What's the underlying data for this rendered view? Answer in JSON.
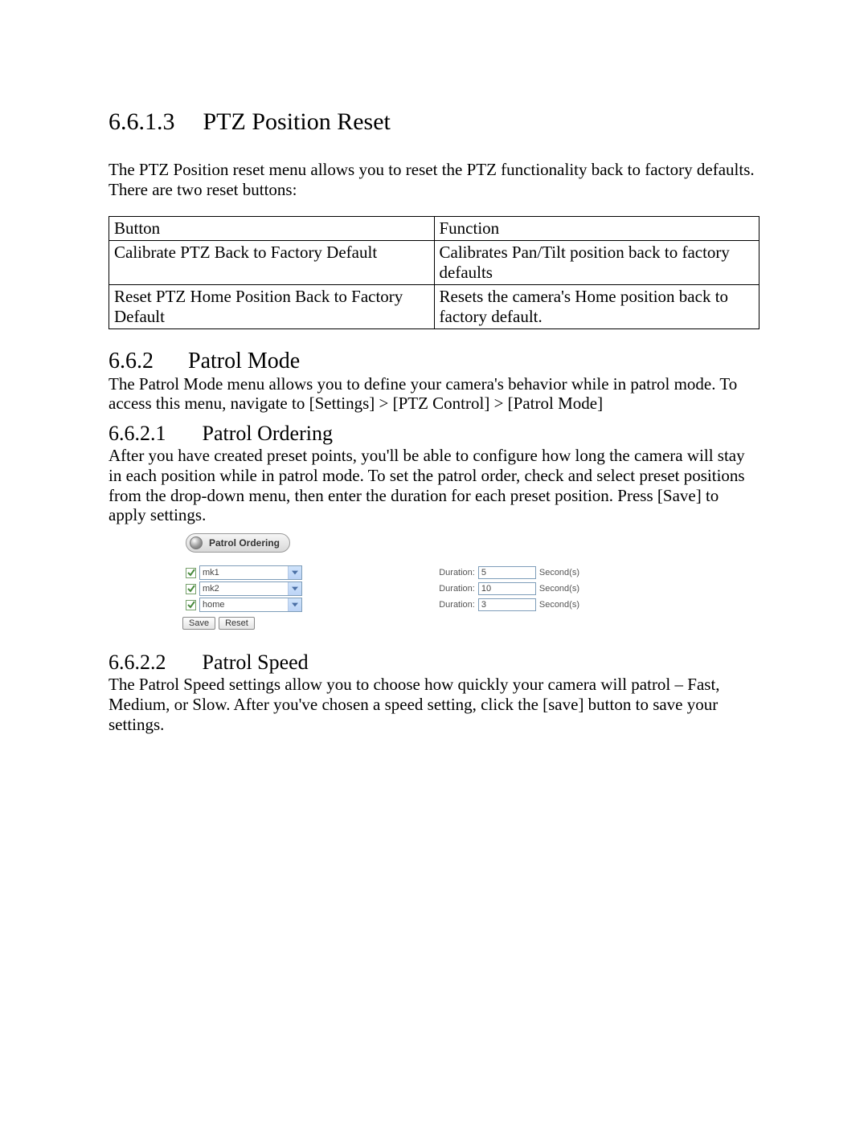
{
  "sec6613": {
    "num": "6.6.1.3",
    "title": "PTZ Position Reset",
    "para": "The PTZ Position reset menu allows you to reset the PTZ functionality back to factory defaults. There are two reset buttons:",
    "table": {
      "h1": "Button",
      "h2": "Function",
      "r1c1": "Calibrate PTZ Back to Factory Default",
      "r1c2": "Calibrates Pan/Tilt position back to factory defaults",
      "r2c1": "Reset PTZ Home Position Back to Factory Default",
      "r2c2": "Resets the camera's Home position back to factory default."
    }
  },
  "sec662": {
    "num": "6.6.2",
    "title": "Patrol Mode",
    "para": "The Patrol Mode menu allows you to define your camera's behavior while in patrol mode. To access this menu, navigate to [Settings] > [PTZ Control] > [Patrol Mode]"
  },
  "sec6621": {
    "num": "6.6.2.1",
    "title": "Patrol Ordering",
    "para": "After you have created preset points, you'll be able to configure how long the camera will stay in each position while in patrol mode. To set the patrol order, check and select preset positions from the drop-down menu, then enter the duration for each preset position. Press [Save] to apply settings."
  },
  "patrol_ui": {
    "panel_title": "Patrol Ordering",
    "duration_label": "Duration:",
    "seconds_label": "Second(s)",
    "save": "Save",
    "reset": "Reset",
    "rows": [
      {
        "preset": "mk1",
        "duration": "5"
      },
      {
        "preset": "mk2",
        "duration": "10"
      },
      {
        "preset": "home",
        "duration": "3"
      }
    ]
  },
  "sec6622": {
    "num": "6.6.2.2",
    "title": "Patrol Speed",
    "para": "The Patrol Speed settings allow you to choose how quickly your camera will patrol – Fast, Medium, or Slow. After you've chosen a speed setting, click the [save] button to save your settings."
  }
}
